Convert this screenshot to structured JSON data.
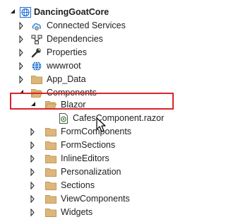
{
  "project": {
    "name": "DancingGoatCore"
  },
  "items": {
    "connected_services": "Connected Services",
    "dependencies": "Dependencies",
    "properties": "Properties",
    "wwwroot": "wwwroot",
    "app_data": "App_Data",
    "components": "Components",
    "blazor": "Blazor",
    "cafes_component": "CafesComponent.razor",
    "form_components": "FormComponents",
    "form_sections": "FormSections",
    "inline_editors": "InlineEditors",
    "personalization": "Personalization",
    "sections": "Sections",
    "view_components": "ViewComponents",
    "widgets": "Widgets"
  },
  "colors": {
    "folder": "#dcb67a",
    "folder_dark": "#c19a57",
    "highlight_border": "#d9242c",
    "globe": "#1e6fd1",
    "cloud": "#1e88e5"
  }
}
